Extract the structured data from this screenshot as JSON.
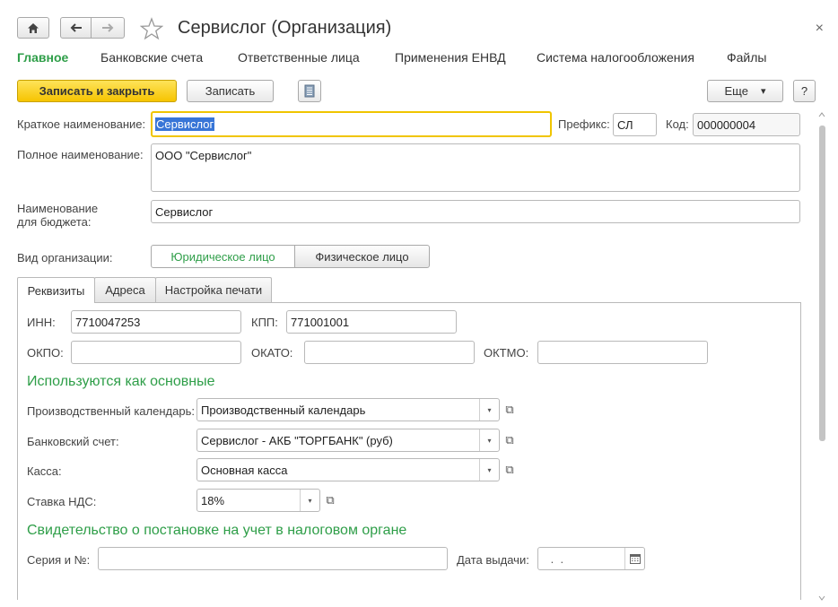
{
  "window": {
    "title": "Сервислог (Организация)",
    "close_glyph": "×"
  },
  "icons": {
    "home": "home-icon",
    "back": "arrow-left-icon",
    "forward": "arrow-right-icon",
    "favorite": "star-icon",
    "report": "document-icon",
    "help_glyph": "?",
    "more_arrow": "▾",
    "dropdown": "▾",
    "open": "⧉",
    "calendar": "calendar-icon"
  },
  "nav_links": [
    "Главное",
    "Банковские счета",
    "Ответственные лица",
    "Применения ЕНВД",
    "Система налогообложения",
    "Файлы"
  ],
  "toolbar": {
    "save_close": "Записать и закрыть",
    "save": "Записать",
    "more": "Еще",
    "help": "?"
  },
  "form": {
    "short_name_label": "Краткое наименование:",
    "short_name": "Сервислог",
    "prefix_label": "Префикс:",
    "prefix": "СЛ",
    "code_label": "Код:",
    "code": "000000004",
    "full_name_label": "Полное наименование:",
    "full_name": "ООО \"Сервислог\"",
    "budget_name_label_1": "Наименование",
    "budget_name_label_2": "для бюджета:",
    "budget_name": "Сервислог",
    "org_type_label": "Вид организации:",
    "org_type_options": [
      "Юридическое лицо",
      "Физическое лицо"
    ],
    "org_type_selected": "Юридическое лицо"
  },
  "tabs": [
    "Реквизиты",
    "Адреса",
    "Настройка печати"
  ],
  "active_tab": "Реквизиты",
  "requisites": {
    "inn_label": "ИНН:",
    "inn": "7710047253",
    "kpp_label": "КПП:",
    "kpp": "771001001",
    "okpo_label": "ОКПО:",
    "okpo": "",
    "okato_label": "ОКАТО:",
    "okato": "",
    "oktmo_label": "ОКТМО:",
    "oktmo": "",
    "main_section_title": "Используются как основные",
    "calendar_label": "Производственный календарь:",
    "calendar": "Производственный календарь",
    "bank_label": "Банковский счет:",
    "bank": "Сервислог - АКБ \"ТОРГБАНК\" (руб)",
    "cash_label": "Касса:",
    "cash": "Основная касса",
    "vat_label": "Ставка НДС:",
    "vat": "18%",
    "cert_section_title": "Свидетельство о постановке на учет в налоговом органе",
    "series_label": "Серия и №:",
    "series": "",
    "issue_date_label": "Дата выдачи:",
    "issue_date": " .  ."
  },
  "colors": {
    "accent_green": "#2e9e48",
    "primary_yellow": "#f6c400",
    "selection_blue": "#3875d7"
  }
}
